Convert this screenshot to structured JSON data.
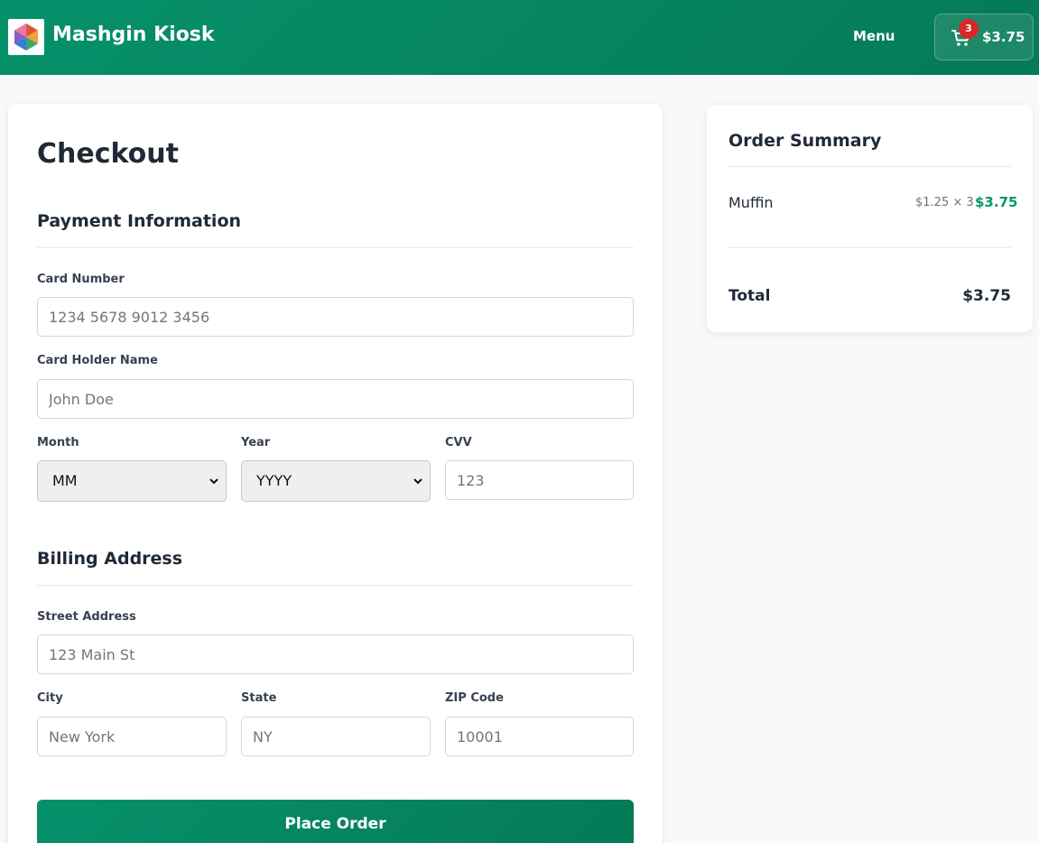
{
  "header": {
    "brand": "Mashgin Kiosk",
    "menu_label": "Menu",
    "cart": {
      "count": "3",
      "total": "$3.75"
    },
    "colors": {
      "primary": "#06916a",
      "badge": "#dc2626"
    }
  },
  "checkout": {
    "title": "Checkout",
    "payment": {
      "heading": "Payment Information",
      "card_number": {
        "label": "Card Number",
        "placeholder": "1234 5678 9012 3456"
      },
      "card_holder": {
        "label": "Card Holder Name",
        "placeholder": "John Doe"
      },
      "month": {
        "label": "Month",
        "value": "MM"
      },
      "year": {
        "label": "Year",
        "value": "YYYY"
      },
      "cvv": {
        "label": "CVV",
        "placeholder": "123"
      }
    },
    "billing": {
      "heading": "Billing Address",
      "street": {
        "label": "Street Address",
        "placeholder": "123 Main St"
      },
      "city": {
        "label": "City",
        "placeholder": "New York"
      },
      "state": {
        "label": "State",
        "placeholder": "NY"
      },
      "zip": {
        "label": "ZIP Code",
        "placeholder": "10001"
      }
    },
    "place_order_label": "Place Order"
  },
  "summary": {
    "title": "Order Summary",
    "items": [
      {
        "name": "Muffin",
        "unit_qty": "$1.25 × 3",
        "price": "$3.75"
      }
    ],
    "total_label": "Total",
    "total_value": "$3.75"
  }
}
